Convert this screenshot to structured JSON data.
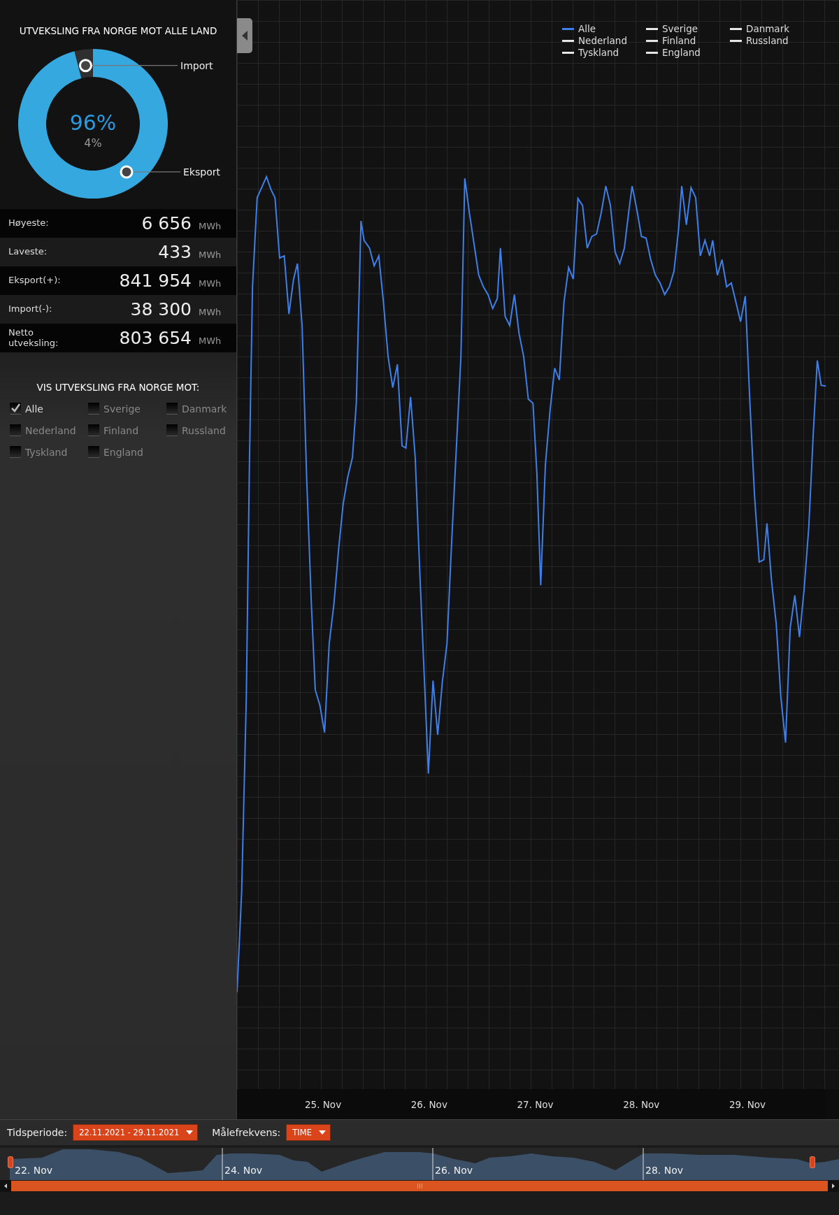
{
  "panel": {
    "title": "UTVEKSLING FRA NORGE MOT ALLE LAND",
    "donut": {
      "chart_data": {
        "type": "donut",
        "categories": [
          "Import",
          "Eksport"
        ],
        "values": [
          4,
          96
        ]
      },
      "primary_pct": "96%",
      "secondary_pct": "4%"
    },
    "stats": [
      {
        "label": "Høyeste:",
        "value": "6 656",
        "unit": "MWh"
      },
      {
        "label": "Laveste:",
        "value": "433",
        "unit": "MWh"
      },
      {
        "label": "Eksport(+):",
        "value": "841 954",
        "unit": "MWh"
      },
      {
        "label": "Import(-):",
        "value": "38 300",
        "unit": "MWh"
      },
      {
        "label": "Netto utveksling:",
        "value": "803 654",
        "unit": "MWh"
      }
    ]
  },
  "filter": {
    "title": "VIS UTVEKSLING FRA NORGE MOT:",
    "options": [
      {
        "label": "Alle",
        "checked": true
      },
      {
        "label": "Sverige",
        "checked": false
      },
      {
        "label": "Danmark",
        "checked": false
      },
      {
        "label": "Nederland",
        "checked": false
      },
      {
        "label": "Finland",
        "checked": false
      },
      {
        "label": "Russland",
        "checked": false
      },
      {
        "label": "Tyskland",
        "checked": false
      },
      {
        "label": "England",
        "checked": false
      }
    ]
  },
  "chart": {
    "legend": [
      {
        "label": "Alle",
        "color": "#3f7fe8"
      },
      {
        "label": "Sverige",
        "color": "#e6e6e6"
      },
      {
        "label": "Danmark",
        "color": "#e6e6e6"
      },
      {
        "label": "Nederland",
        "color": "#e6e6e6"
      },
      {
        "label": "Finland",
        "color": "#e6e6e6"
      },
      {
        "label": "Russland",
        "color": "#e6e6e6"
      },
      {
        "label": "Tyskland",
        "color": "#e6e6e6"
      },
      {
        "label": "England",
        "color": "#e6e6e6"
      }
    ],
    "x_labels": [
      "25. Nov",
      "26. Nov",
      "27. Nov",
      "28. Nov",
      "29. Nov"
    ]
  },
  "controls": {
    "period_label": "Tidsperiode:",
    "period_value": "22.11.2021 - 29.11.2021",
    "frequency_label": "Målefrekvens:",
    "frequency_value": "TIME"
  },
  "navigator": {
    "labels": [
      "22. Nov",
      "24. Nov",
      "26. Nov",
      "28. Nov"
    ]
  }
}
